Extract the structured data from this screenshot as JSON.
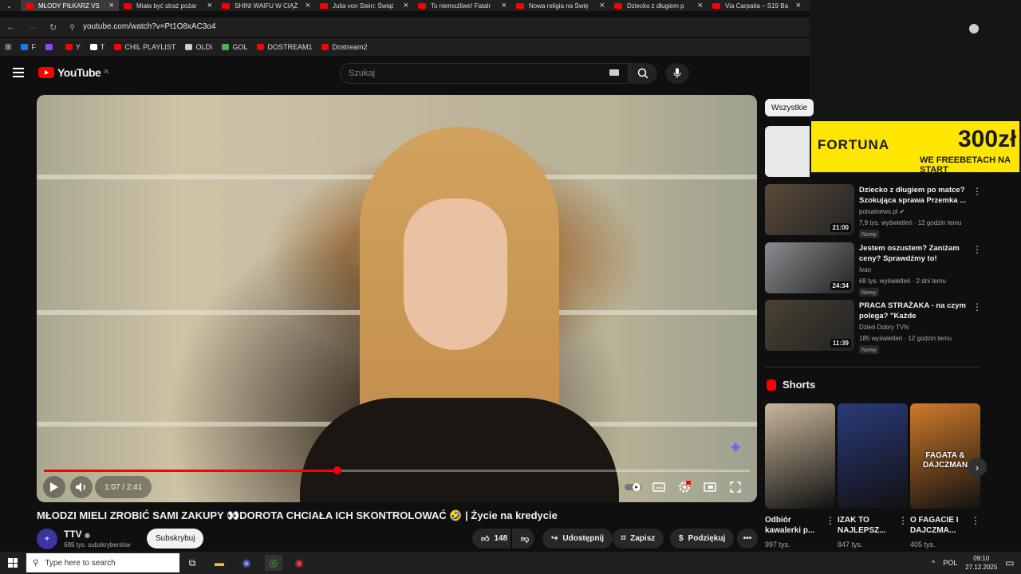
{
  "browser": {
    "tabs": [
      {
        "label": "MŁODY PIŁKARZ VS",
        "active": true
      },
      {
        "label": "Miała być straż pożar"
      },
      {
        "label": "SHINI WAIFU W CIĄŻ"
      },
      {
        "label": "Julia von Stein: Świąt"
      },
      {
        "label": "To niemożliwe! Fatalr"
      },
      {
        "label": "Nowa religia na Świę"
      },
      {
        "label": "Dziecko z długiem p"
      },
      {
        "label": "Via Carpatia – S19 Ba"
      }
    ],
    "tab_close": "×",
    "url": "youtube.com/watch?v=Pt1O8xAC3o4",
    "bookmarks": [
      {
        "label": "F",
        "icon": "facebook-icon"
      },
      {
        "label": "",
        "icon": "twitch-icon"
      },
      {
        "label": "Y",
        "icon": "youtube-icon"
      },
      {
        "label": "T",
        "icon": "x-icon"
      },
      {
        "label": "CHIL PLAYLIST",
        "icon": "youtube-icon"
      },
      {
        "label": "OLD\\",
        "icon": "folder-icon"
      },
      {
        "label": "GOL",
        "icon": "gol-icon"
      },
      {
        "label": "DOSTREAM1",
        "icon": "youtube-icon"
      },
      {
        "label": "Dostream2",
        "icon": "youtube-icon"
      }
    ]
  },
  "header": {
    "logo": "YouTube",
    "country": "PL",
    "search_placeholder": "Szukaj"
  },
  "player": {
    "time": "1:07 / 2:41",
    "progress": 0.4159
  },
  "video": {
    "title": "MŁODZI MIELI ZROBIĆ SAMI ZAKUPY 👀DOROTA CHCIAŁA ICH SKONTROLOWAĆ 🤣 | Życie na kredycie",
    "channel": "TTV",
    "subscribers": "689 tys. subskrybentów",
    "subscribe": "Subskrybuj",
    "likes": "148",
    "share": "Udostępnij",
    "save": "Zapisz",
    "thanks": "Podziękuj",
    "more": "•••"
  },
  "sidebar": {
    "chip": "Wszystkie",
    "ad": {
      "brand": "FORTUNA",
      "amount": "300zł",
      "sub": "WE FREEBETACH NA START"
    },
    "recommendations": [
      {
        "title": "Dziecko z długiem po matce? Szokująca sprawa Przemka ...",
        "channel": "polsatnews.pl ✔",
        "meta": "7,9 tys. wyświetleń · 12 godzin temu",
        "badge": "Nowy",
        "duration": "21:00",
        "color": "#5a4a3a"
      },
      {
        "title": "Jestem oszustem? Zaniżam ceny? Sprawdźmy to!",
        "channel": "Ivan",
        "meta": "68 tys. wyświetleń · 2 dni temu",
        "badge": "Nowy",
        "duration": "24:34",
        "color": "#8a8c90"
      },
      {
        "title": "PRACA STRAŻAKA - na czym polega? \"Każde poszkodowan...",
        "channel": "Dzień Dobry TVN",
        "meta": "185 wyświetleń · 12 godzin temu",
        "badge": "Nowy",
        "duration": "11:39",
        "color": "#4a4232"
      }
    ],
    "kebab": "⋮",
    "shorts_title": "Shorts",
    "shorts": [
      {
        "title": "Odbiór kawalerki p...",
        "views": "997 tys.",
        "color": "#c9b79c"
      },
      {
        "title": "IZAK TO NAJLEPSZ...",
        "views": "847 tys.",
        "color": "#2a3a7a"
      },
      {
        "title": "O FAGACIE I DAJCZMA...",
        "views": "405 tys.",
        "color": "#d07a2a"
      }
    ],
    "short_overlay": "FAGATA & DAJCZMAN"
  },
  "taskbar": {
    "search_placeholder": "Type here to search",
    "lang": "POL",
    "time": "09:10",
    "date": "27.12.2025"
  }
}
